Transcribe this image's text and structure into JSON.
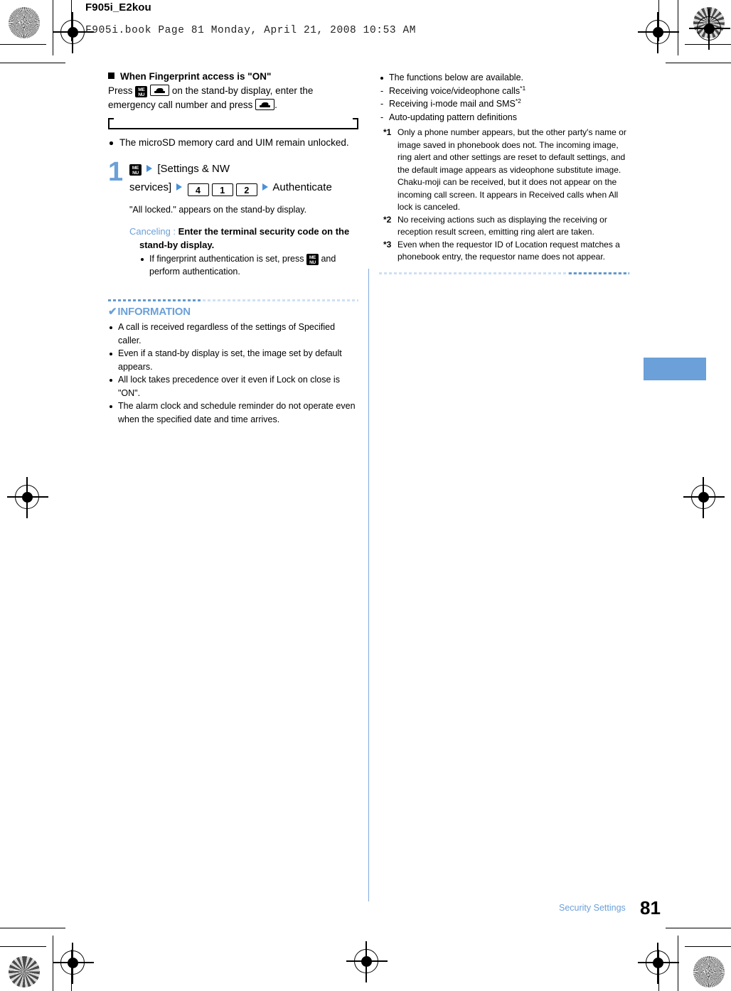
{
  "header": {
    "book_title": "F905i_E2kou",
    "file_meta": "F905i.book  Page 81  Monday, April 21, 2008  10:53 AM"
  },
  "colors": {
    "accent_blue": "#6ba0d8",
    "rule_blue_light": "#cfe0f2",
    "rule_blue_strong": "#6699cc"
  },
  "left_column": {
    "section_heading": "When Fingerprint access is \"ON\"",
    "section_body_pre": "Press",
    "section_body_mid": "on the stand-by display, enter the",
    "section_body_line2": "emergency call number and press",
    "section_body_end": ".",
    "after_bracket_bullets": [
      "The microSD memory card and UIM remain unlocked."
    ],
    "step": {
      "number": "1",
      "menu_key_label_top": "ME",
      "menu_key_label_bottom": "NU",
      "settings_label": "[Settings & NW",
      "settings_label_cont": "services]",
      "keys": [
        "4",
        "1",
        "2"
      ],
      "authenticate_label": "Authenticate",
      "note": "\"All locked.\" appears on the stand-by display.",
      "canceling_label": "Canceling :",
      "canceling_text": "Enter the terminal security code on the",
      "canceling_text_cont": "stand-by display.",
      "sub_bullets_pre": "If fingerprint authentication is set, press",
      "sub_bullets_post": "and",
      "sub_bullets_cont": "perform authentication."
    },
    "information": {
      "check_glyph": "✔",
      "title": "INFORMATION",
      "items": [
        "A call is received regardless of the settings of Specified caller.",
        "Even if a stand-by display is set, the image set by default appears.",
        "All lock takes precedence over it even if Lock on close is \"ON\".",
        "The alarm clock and schedule reminder do not operate even when the specified date and time arrives."
      ]
    }
  },
  "right_column": {
    "intro_bullet": "The functions below are available.",
    "dash_items": [
      {
        "text": "Receiving voice/videophone calls",
        "sup": "*1"
      },
      {
        "text": "Receiving i-mode mail and SMS",
        "sup": "*2"
      },
      {
        "text": "Auto-updating pattern definitions",
        "sup": ""
      }
    ],
    "footnotes": [
      {
        "mark": "*1",
        "text": "Only a phone number appears, but the other party's name or image saved in phonebook does not. The incoming image, ring alert and other settings are reset to default settings, and the default image appears as videophone substitute image. Chaku-moji can be received, but it does not appear on the incoming call screen. It appears in Received calls when All lock is canceled."
      },
      {
        "mark": "*2",
        "text": "No receiving actions such as displaying the receiving or reception result screen, emitting ring alert are taken."
      },
      {
        "mark": "*3",
        "text": "Even when the requestor ID of Location request matches a phonebook entry, the requestor name does not appear."
      }
    ]
  },
  "footer": {
    "chapter": "Security Settings",
    "page_number": "81"
  }
}
